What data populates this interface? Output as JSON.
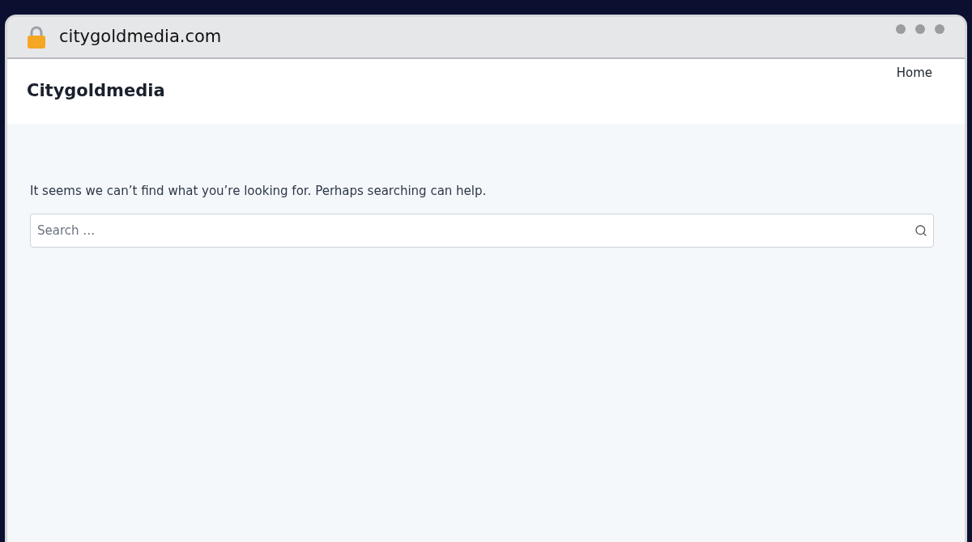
{
  "address_bar": {
    "url": "citygoldmedia.com"
  },
  "site": {
    "title": "Citygoldmedia",
    "nav": [
      {
        "label": "Home"
      }
    ]
  },
  "content": {
    "message": "It seems we can’t find what you’re looking for. Perhaps searching can help.",
    "search": {
      "placeholder": "Search …"
    }
  }
}
